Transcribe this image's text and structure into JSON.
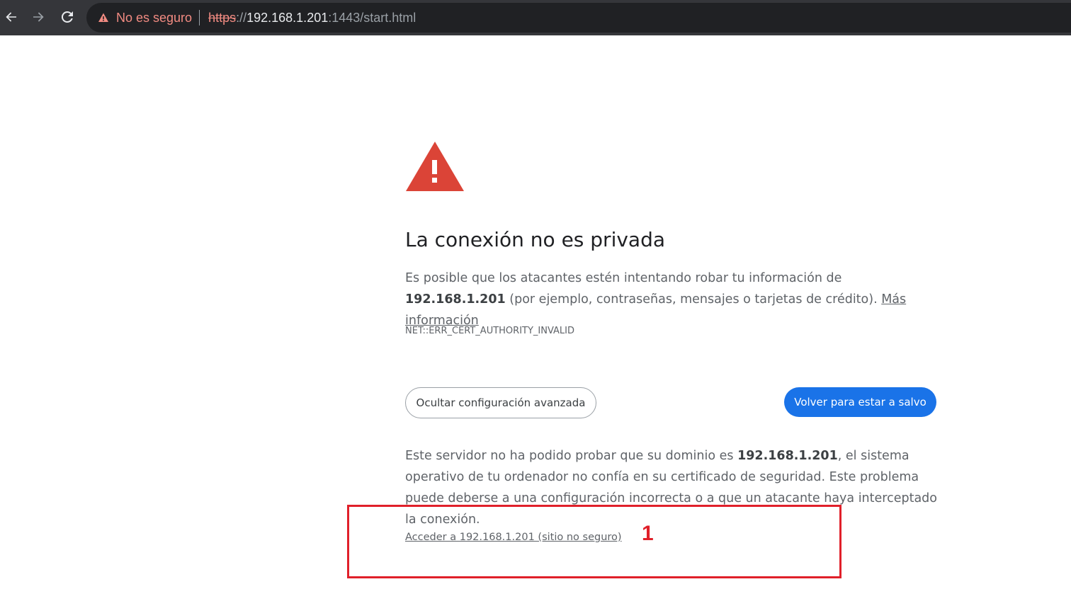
{
  "browser": {
    "security_label": "No es seguro",
    "url_scheme": "https",
    "url_sep": "://",
    "url_host": "192.168.1.201",
    "url_rest": ":1443/start.html"
  },
  "page": {
    "title": "La conexión no es privada",
    "intro_before": "Es posible que los atacantes estén intentando robar tu información de ",
    "intro_host": "192.168.1.201",
    "intro_after": " (por ejemplo, contraseñas, mensajes o tarjetas de crédito). ",
    "more_info_link": "Más información",
    "error_code": "NET::ERR_CERT_AUTHORITY_INVALID",
    "advanced_button": "Ocultar configuración avanzada",
    "back_button": "Volver para estar a salvo",
    "details_before": "Este servidor no ha podido probar que su dominio es ",
    "details_host": "192.168.1.201",
    "details_after": ", el sistema operativo de tu ordenador no confía en su certificado de seguridad. Este problema puede deberse a una configuración incorrecta o a que un atacante haya interceptado la conexión.",
    "proceed_link": "Acceder a 192.168.1.201 (sitio no seguro)"
  },
  "annotation": {
    "number": "1",
    "color": "#e0202a"
  },
  "colors": {
    "toolbar": "#35363a",
    "primary": "#1a73e8",
    "warning": "#db4437"
  }
}
